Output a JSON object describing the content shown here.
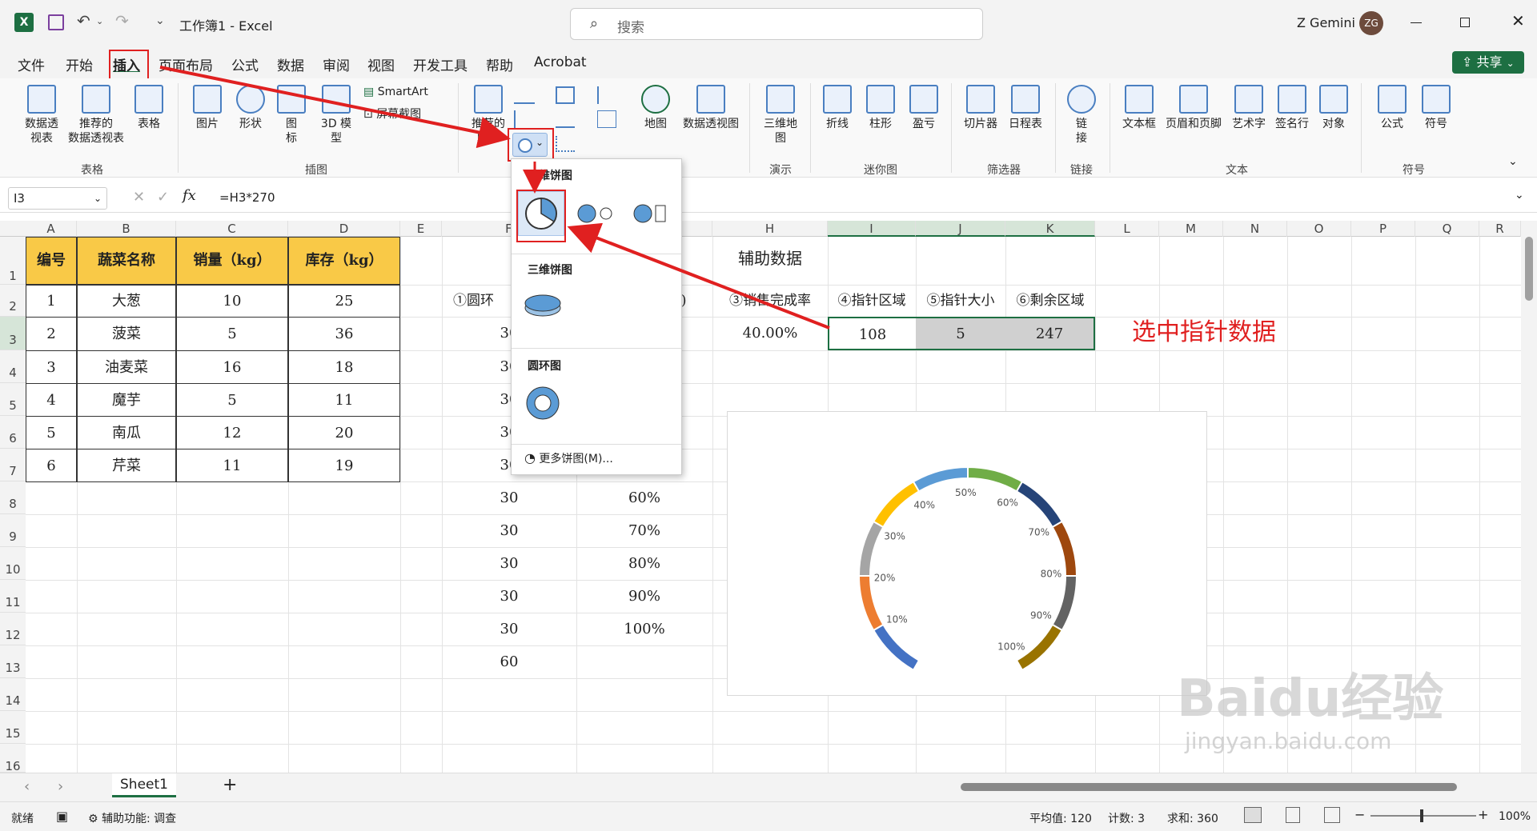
{
  "app": {
    "title": "工作簿1 - Excel",
    "search_placeholder": "搜索",
    "user_name": "Z Gemini",
    "user_initials": "ZG",
    "share_label": "共享",
    "colors": {
      "excel_green": "#1d6f42",
      "accent_red": "#e02020",
      "header_fill": "#f9c947"
    }
  },
  "menu": [
    "文件",
    "开始",
    "插入",
    "页面布局",
    "公式",
    "数据",
    "审阅",
    "视图",
    "开发工具",
    "帮助",
    "Acrobat"
  ],
  "ribbon": {
    "groups": [
      "表格",
      "插图",
      "演示",
      "迷你图",
      "筛选器",
      "链接",
      "文本",
      "符号"
    ],
    "buttons": {
      "pivot": "数据透\n视表",
      "rec_pivot": "推荐的\n数据透视表",
      "table": "表格",
      "picture": "图片",
      "shape": "形状",
      "icon": "图\n标",
      "model3d": "3D 模\n型",
      "smartart": "SmartArt",
      "screenshot": "屏幕截图",
      "rec_chart": "推荐的\n图表",
      "map": "地图",
      "pivot_chart": "数据透视图",
      "map3d": "三维地\n图",
      "line": "折线",
      "column": "柱形",
      "winloss": "盈亏",
      "slicer": "切片器",
      "timeline": "日程表",
      "link": "链\n接",
      "textbox": "文本框",
      "header_footer": "页眉和页脚",
      "wordart": "艺术字",
      "signature": "签名行",
      "object": "对象",
      "equation": "公式",
      "symbol": "符号"
    }
  },
  "formula_bar": {
    "name_box": "I3",
    "formula": "=H3*270"
  },
  "columns": [
    "A",
    "B",
    "C",
    "D",
    "E",
    "F",
    "G",
    "H",
    "I",
    "J",
    "K",
    "L",
    "M",
    "N",
    "O",
    "P",
    "Q",
    "R"
  ],
  "rows": [
    "1",
    "2",
    "3",
    "4",
    "5",
    "6",
    "7",
    "8",
    "9",
    "10",
    "11",
    "12",
    "13",
    "14",
    "15",
    "16"
  ],
  "table1": {
    "headers": [
      "编号",
      "蔬菜名称",
      "销量（kg）",
      "库存（kg）"
    ],
    "rows": [
      [
        "1",
        "大葱",
        "10",
        "25"
      ],
      [
        "2",
        "菠菜",
        "5",
        "36"
      ],
      [
        "3",
        "油麦菜",
        "16",
        "18"
      ],
      [
        "4",
        "魔芋",
        "5",
        "11"
      ],
      [
        "5",
        "南瓜",
        "12",
        "20"
      ],
      [
        "6",
        "芹菜",
        "11",
        "19"
      ]
    ]
  },
  "aux": {
    "title": "辅助数据",
    "headers": [
      "①圆环",
      "5)",
      "③销售完成率",
      "④指针区域",
      "⑤指针大小",
      "⑥剩余区域"
    ],
    "rate": "40.00%",
    "pointer": "108",
    "size": "5",
    "rest": "247",
    "f_values": [
      "30",
      "30",
      "30",
      "30",
      "30",
      "30",
      "30",
      "30",
      "30",
      "30",
      "60"
    ],
    "g_values": [
      "60%",
      "70%",
      "80%",
      "90%",
      "100%"
    ]
  },
  "annotation": "选中指针数据",
  "dropdown": {
    "section1": "二维饼图",
    "section2": "三维饼图",
    "section3": "圆环图",
    "more": "更多饼图(M)..."
  },
  "chart_data": {
    "type": "pie",
    "subtype": "doughnut-gauge",
    "categories": [
      "10%",
      "20%",
      "30%",
      "40%",
      "50%",
      "60%",
      "70%",
      "80%",
      "90%",
      "100%"
    ],
    "values": [
      30,
      30,
      30,
      30,
      30,
      30,
      30,
      30,
      30,
      30,
      60
    ],
    "colors": [
      "#4472c4",
      "#ed7d31",
      "#a5a5a5",
      "#ffc000",
      "#5b9bd5",
      "#70ad47",
      "#264478",
      "#9e480e",
      "#636363",
      "#997300"
    ]
  },
  "sheet": {
    "tab": "Sheet1",
    "add": "+"
  },
  "status": {
    "ready": "就绪",
    "accessibility": "辅助功能: 调查",
    "average": "平均值: 120",
    "count": "计数: 3",
    "sum": "求和: 360",
    "zoom": "100%"
  },
  "watermark": "Baidu经验",
  "watermark_url": "jingyan.baidu.com"
}
